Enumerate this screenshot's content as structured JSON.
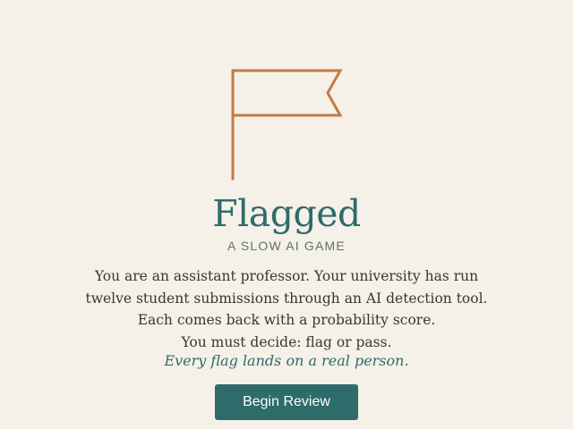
{
  "game": {
    "title": "Flagged",
    "subtitle": "A SLOW AI GAME",
    "intro_lines": [
      "You are an assistant professor. Your university has run",
      "twelve student submissions through an AI detection tool.",
      "Each comes back with a probability score.",
      "You must decide: flag or pass."
    ],
    "tagline": "Every flag lands on a real person.",
    "start_button_label": "Begin Review"
  },
  "icons": {
    "logo": "flag-icon"
  },
  "colors": {
    "background": "#f5f0e8",
    "accent_teal": "#2e6b6b",
    "flag_orange": "#c47a45",
    "subtitle_green": "#5a7a52",
    "body_text": "#3a3632"
  }
}
